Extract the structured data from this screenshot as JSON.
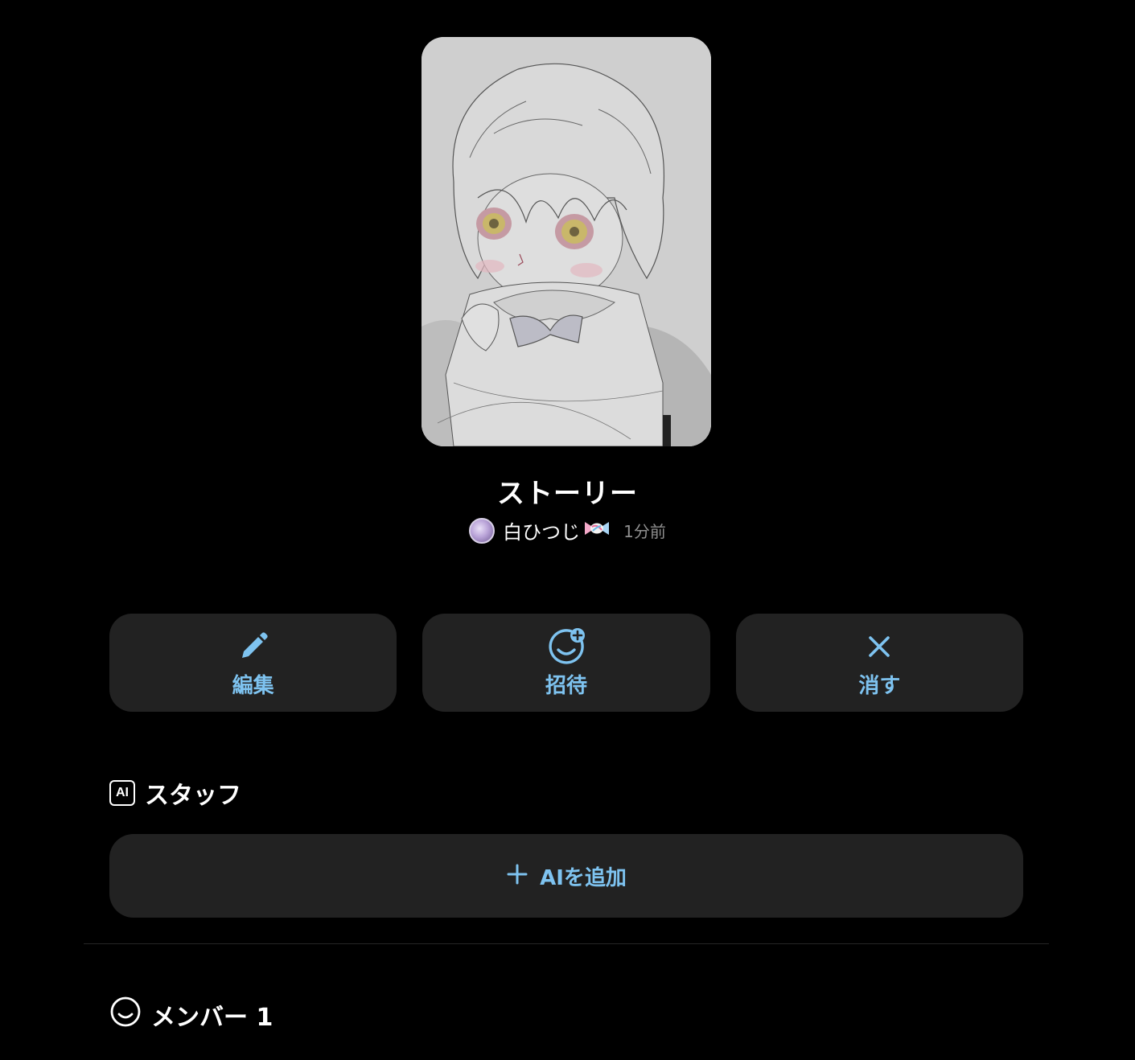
{
  "story": {
    "title": "ストーリー",
    "author": "白ひつじ",
    "time_ago": "1分前"
  },
  "actions": {
    "edit": {
      "label": "編集",
      "icon": "pencil-icon"
    },
    "invite": {
      "label": "招待",
      "icon": "add-smiley-icon"
    },
    "delete": {
      "label": "消す",
      "icon": "close-icon"
    }
  },
  "staff": {
    "heading": "スタッフ",
    "badge": "AI",
    "add_button_label": "AIを追加"
  },
  "members": {
    "heading": "メンバー 1"
  },
  "colors": {
    "accent": "#7ec3f0",
    "card": "#222222",
    "background": "#000000"
  }
}
